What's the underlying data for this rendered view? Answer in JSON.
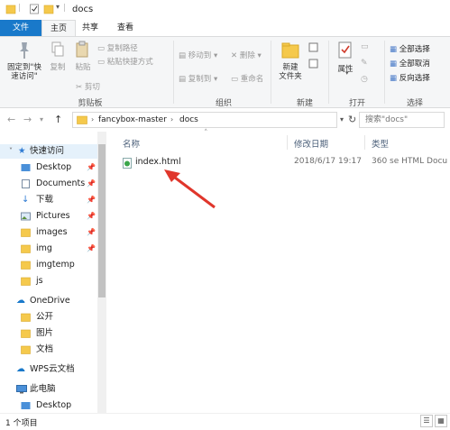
{
  "window": {
    "title": "docs"
  },
  "tabs": {
    "file": "文件",
    "home": "主页",
    "share": "共享",
    "view": "查看"
  },
  "ribbon": {
    "clipboard": {
      "pin_quick_access": "固定到\"快\n速访问\"",
      "pin_line1": "固定到\"快",
      "pin_line2": "速访问\"",
      "copy": "复制",
      "paste": "粘贴",
      "copy_path": "复制路径",
      "paste_shortcut": "粘贴快捷方式",
      "cut": "剪切",
      "group": "剪贴板"
    },
    "organize": {
      "move_to": "移动到",
      "copy_to": "复制到",
      "delete": "删除",
      "rename": "重命名",
      "group": "组织"
    },
    "new": {
      "new_folder_line1": "新建",
      "new_folder_line2": "文件夹",
      "group": "新建"
    },
    "open": {
      "properties": "属性",
      "group": "打开"
    },
    "select": {
      "select_all": "全部选择",
      "select_none": "全部取消",
      "invert": "反向选择",
      "group": "选择"
    }
  },
  "address": {
    "crumbs": [
      "fancybox-master",
      "docs"
    ],
    "search_placeholder": "搜索\"docs\""
  },
  "navpane": {
    "quick_access": "快速访问",
    "items": [
      {
        "label": "Desktop",
        "pinned": "📌"
      },
      {
        "label": "Documents",
        "pinned": "📌"
      },
      {
        "label": "下载",
        "pinned": "📌"
      },
      {
        "label": "Pictures",
        "pinned": "📌"
      },
      {
        "label": "images",
        "pinned": "📌"
      },
      {
        "label": "img",
        "pinned": "📌"
      },
      {
        "label": "imgtemp",
        "pinned": ""
      },
      {
        "label": "js",
        "pinned": ""
      }
    ],
    "onedrive": "OneDrive",
    "onedrive_items": [
      "公开",
      "图片",
      "文档"
    ],
    "wps": "WPS云文档",
    "this_pc": "此电脑",
    "this_pc_items": [
      "Desktop"
    ]
  },
  "columns": {
    "name": "名称",
    "modified": "修改日期",
    "type": "类型"
  },
  "files": [
    {
      "name": "index.html",
      "modified": "2018/6/17 19:17",
      "type": "360 se HTML Docu"
    }
  ],
  "status": {
    "count": "1 个项目"
  },
  "colors": {
    "accent": "#1979ca",
    "arrow": "#e0362b",
    "folder": "#f5c94c"
  }
}
